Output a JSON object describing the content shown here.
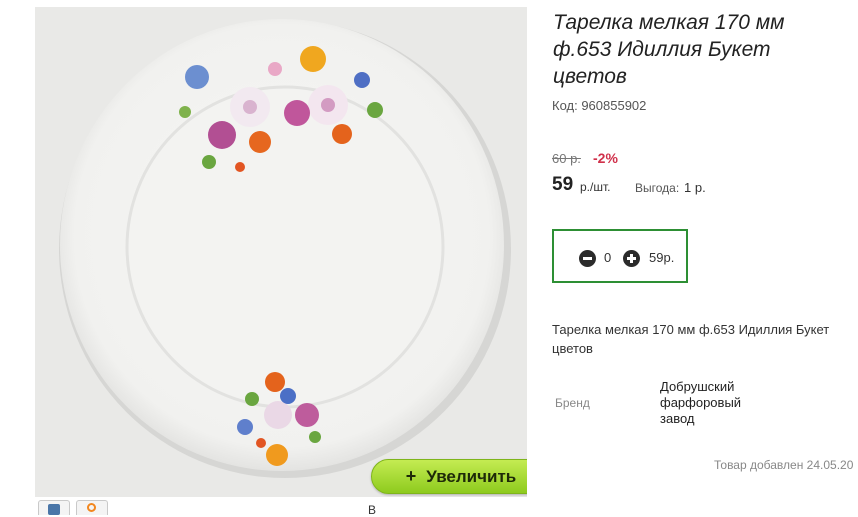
{
  "product": {
    "title": "Тарелка мелкая 170 мм ф.653 Идиллия Букет цветов",
    "code": "Код: 960855902",
    "old_price": "60 р.",
    "discount": "-2%",
    "price": "59",
    "price_unit": "р./шт.",
    "benefit_label": "Выгода:",
    "benefit_value": "1 р.",
    "description": "Тарелка мелкая 170 мм ф.653 Идиллия Букет цветов",
    "brand_label": "Бренд",
    "brand_value": "Добрушский фарфоровый завод",
    "added": "Товар добавлен 24.05.20"
  },
  "cart": {
    "quantity": "0",
    "total": "59р."
  },
  "gallery": {
    "zoom_label": "Увеличить",
    "zoom_icon": "+"
  },
  "share": {
    "buttons": [
      "vk-icon",
      "odnoklassniki-icon"
    ]
  },
  "footer": {
    "cut_text": "В"
  }
}
